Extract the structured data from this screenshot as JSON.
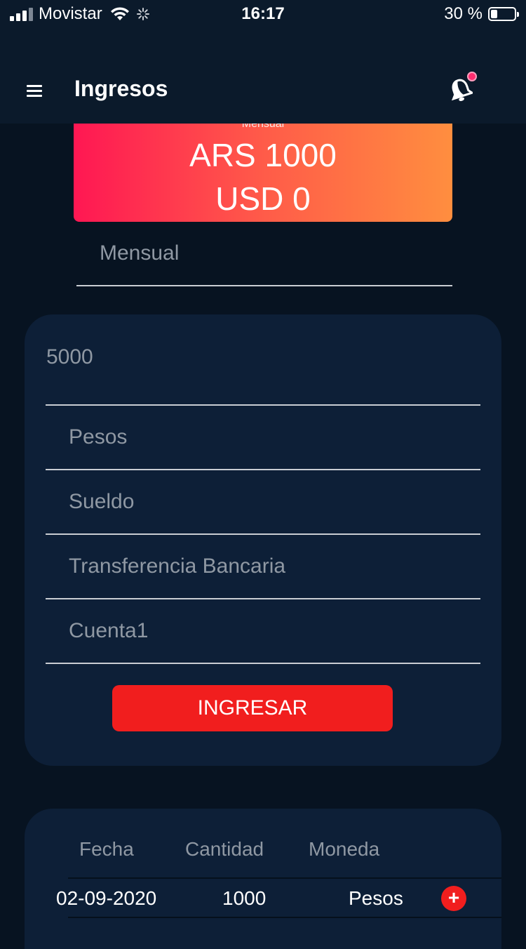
{
  "status_bar": {
    "carrier": "Movistar",
    "time": "16:17",
    "battery": "30 %",
    "battery_level": 0.3,
    "signal_bars": 3
  },
  "header": {
    "title": "Ingresos",
    "menu_icon": "hamburger-menu-icon",
    "notification_icon": "bell-icon",
    "has_notification": true
  },
  "summary": {
    "period_label": "Mensual",
    "ars": "ARS 1000",
    "usd": "USD 0"
  },
  "period_select": {
    "value": "Mensual"
  },
  "form": {
    "amount": "5000",
    "currency": "Pesos",
    "category": "Sueldo",
    "method": "Transferencia Bancaria",
    "account": "Cuenta1",
    "submit_label": "INGRESAR"
  },
  "table": {
    "headers": [
      "Fecha",
      "Cantidad",
      "Moneda"
    ],
    "rows": [
      {
        "fecha": "02-09-2020",
        "cantidad": "1000",
        "moneda": "Pesos"
      }
    ],
    "action_label": "+"
  },
  "colors": {
    "background": "#071321",
    "header": "#0b1a2b",
    "card": "#0d1f37",
    "accent_red": "#f11e1e",
    "gradient_start": "#ff1753",
    "gradient_end": "#ff8e3f"
  }
}
